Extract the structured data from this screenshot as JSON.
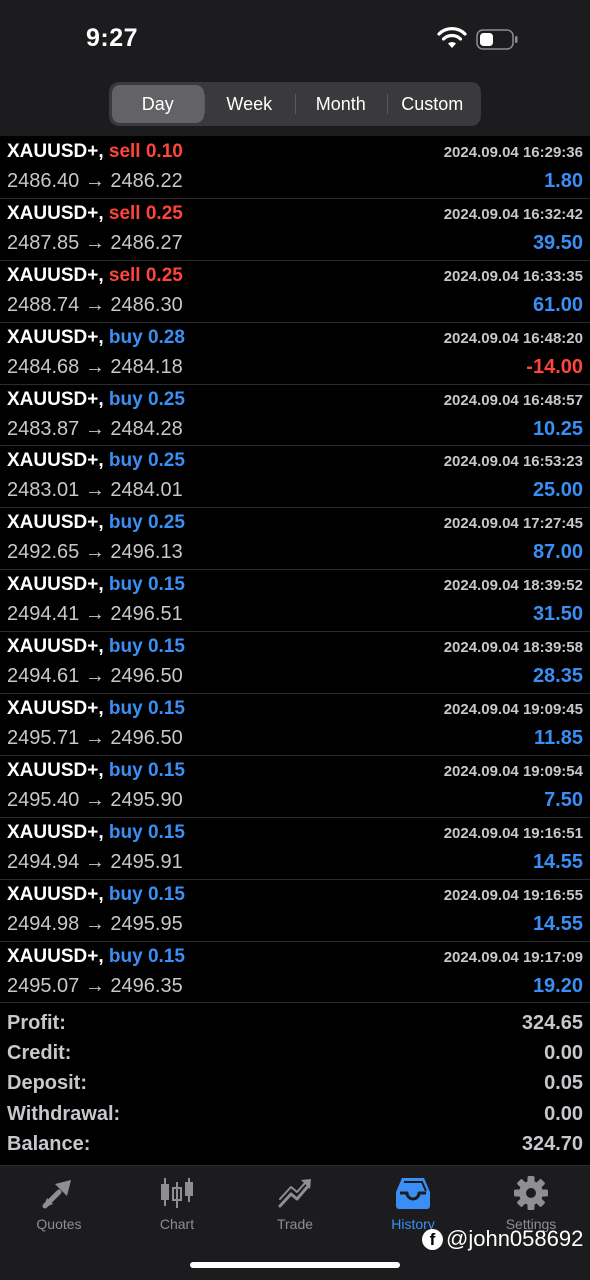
{
  "status": {
    "time": "9:27"
  },
  "periods": [
    "Day",
    "Week",
    "Month",
    "Custom"
  ],
  "active_period": "Day",
  "deals": [
    {
      "symbol": "XAUUSD+,",
      "type": "sell",
      "volume": "sell 0.10",
      "datetime": "2024.09.04 16:29:36",
      "prices": "2486.40 → 2486.22",
      "profit": "1.80"
    },
    {
      "symbol": "XAUUSD+,",
      "type": "sell",
      "volume": "sell 0.25",
      "datetime": "2024.09.04 16:32:42",
      "prices": "2487.85 → 2486.27",
      "profit": "39.50"
    },
    {
      "symbol": "XAUUSD+,",
      "type": "sell",
      "volume": "sell 0.25",
      "datetime": "2024.09.04 16:33:35",
      "prices": "2488.74 → 2486.30",
      "profit": "61.00"
    },
    {
      "symbol": "XAUUSD+,",
      "type": "buy",
      "volume": "buy 0.28",
      "datetime": "2024.09.04 16:48:20",
      "prices": "2484.68 → 2484.18",
      "profit": "-14.00"
    },
    {
      "symbol": "XAUUSD+,",
      "type": "buy",
      "volume": "buy 0.25",
      "datetime": "2024.09.04 16:48:57",
      "prices": "2483.87 → 2484.28",
      "profit": "10.25"
    },
    {
      "symbol": "XAUUSD+,",
      "type": "buy",
      "volume": "buy 0.25",
      "datetime": "2024.09.04 16:53:23",
      "prices": "2483.01 → 2484.01",
      "profit": "25.00"
    },
    {
      "symbol": "XAUUSD+,",
      "type": "buy",
      "volume": "buy 0.25",
      "datetime": "2024.09.04 17:27:45",
      "prices": "2492.65 → 2496.13",
      "profit": "87.00"
    },
    {
      "symbol": "XAUUSD+,",
      "type": "buy",
      "volume": "buy 0.15",
      "datetime": "2024.09.04 18:39:52",
      "prices": "2494.41 → 2496.51",
      "profit": "31.50"
    },
    {
      "symbol": "XAUUSD+,",
      "type": "buy",
      "volume": "buy 0.15",
      "datetime": "2024.09.04 18:39:58",
      "prices": "2494.61 → 2496.50",
      "profit": "28.35"
    },
    {
      "symbol": "XAUUSD+,",
      "type": "buy",
      "volume": "buy 0.15",
      "datetime": "2024.09.04 19:09:45",
      "prices": "2495.71 → 2496.50",
      "profit": "11.85"
    },
    {
      "symbol": "XAUUSD+,",
      "type": "buy",
      "volume": "buy 0.15",
      "datetime": "2024.09.04 19:09:54",
      "prices": "2495.40 → 2495.90",
      "profit": "7.50"
    },
    {
      "symbol": "XAUUSD+,",
      "type": "buy",
      "volume": "buy 0.15",
      "datetime": "2024.09.04 19:16:51",
      "prices": "2494.94 → 2495.91",
      "profit": "14.55"
    },
    {
      "symbol": "XAUUSD+,",
      "type": "buy",
      "volume": "buy 0.15",
      "datetime": "2024.09.04 19:16:55",
      "prices": "2494.98 → 2495.95",
      "profit": "14.55"
    },
    {
      "symbol": "XAUUSD+,",
      "type": "buy",
      "volume": "buy 0.15",
      "datetime": "2024.09.04 19:17:09",
      "prices": "2495.07 → 2496.35",
      "profit": "19.20"
    }
  ],
  "summary": [
    {
      "label": "Profit:",
      "value": "324.65"
    },
    {
      "label": "Credit:",
      "value": "0.00"
    },
    {
      "label": "Deposit:",
      "value": "0.05"
    },
    {
      "label": "Withdrawal:",
      "value": "0.00"
    },
    {
      "label": "Balance:",
      "value": "324.70"
    }
  ],
  "tabs": [
    {
      "label": "Quotes",
      "icon": "quotes-icon"
    },
    {
      "label": "Chart",
      "icon": "candlestick-chart-icon"
    },
    {
      "label": "Trade",
      "icon": "trade-icon"
    },
    {
      "label": "History",
      "icon": "history-inbox-icon",
      "active": true
    },
    {
      "label": "Settings",
      "icon": "gear-icon"
    }
  ],
  "watermark": "@john058692",
  "colors": {
    "sell": "#ff453a",
    "buy": "#3a8ff5",
    "active_tab": "#3a8ff5",
    "inactive_tab": "#8e8e93"
  }
}
